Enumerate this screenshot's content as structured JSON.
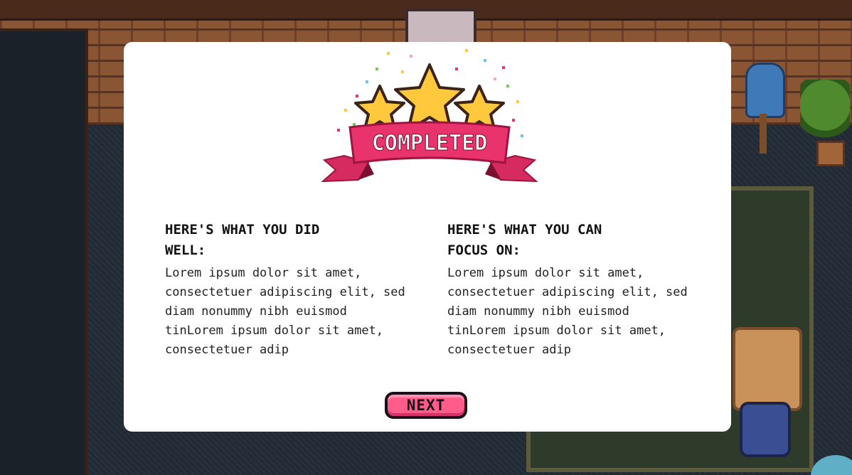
{
  "modal": {
    "badge": {
      "text": "COMPLETED",
      "icon": "completed-stars-badge-icon"
    },
    "left": {
      "heading": "HERE'S WHAT YOU DID WELL:",
      "body": "Lorem ipsum dolor sit amet, consectetuer adipiscing elit, sed diam nonummy nibh euismod tinLorem ipsum dolor sit amet, consectetuer adip"
    },
    "right": {
      "heading": "HERE'S WHAT YOU CAN FOCUS ON:",
      "body": "Lorem ipsum dolor sit amet, consectetuer adipiscing elit, sed diam nonummy nibh euismod tinLorem ipsum dolor sit amet, consectetuer adip"
    },
    "next_label": "NEXT"
  },
  "colors": {
    "modal_bg": "#ffffff",
    "ribbon": "#e8336d",
    "star": "#ffc83d",
    "button": "#ff5c8a"
  }
}
